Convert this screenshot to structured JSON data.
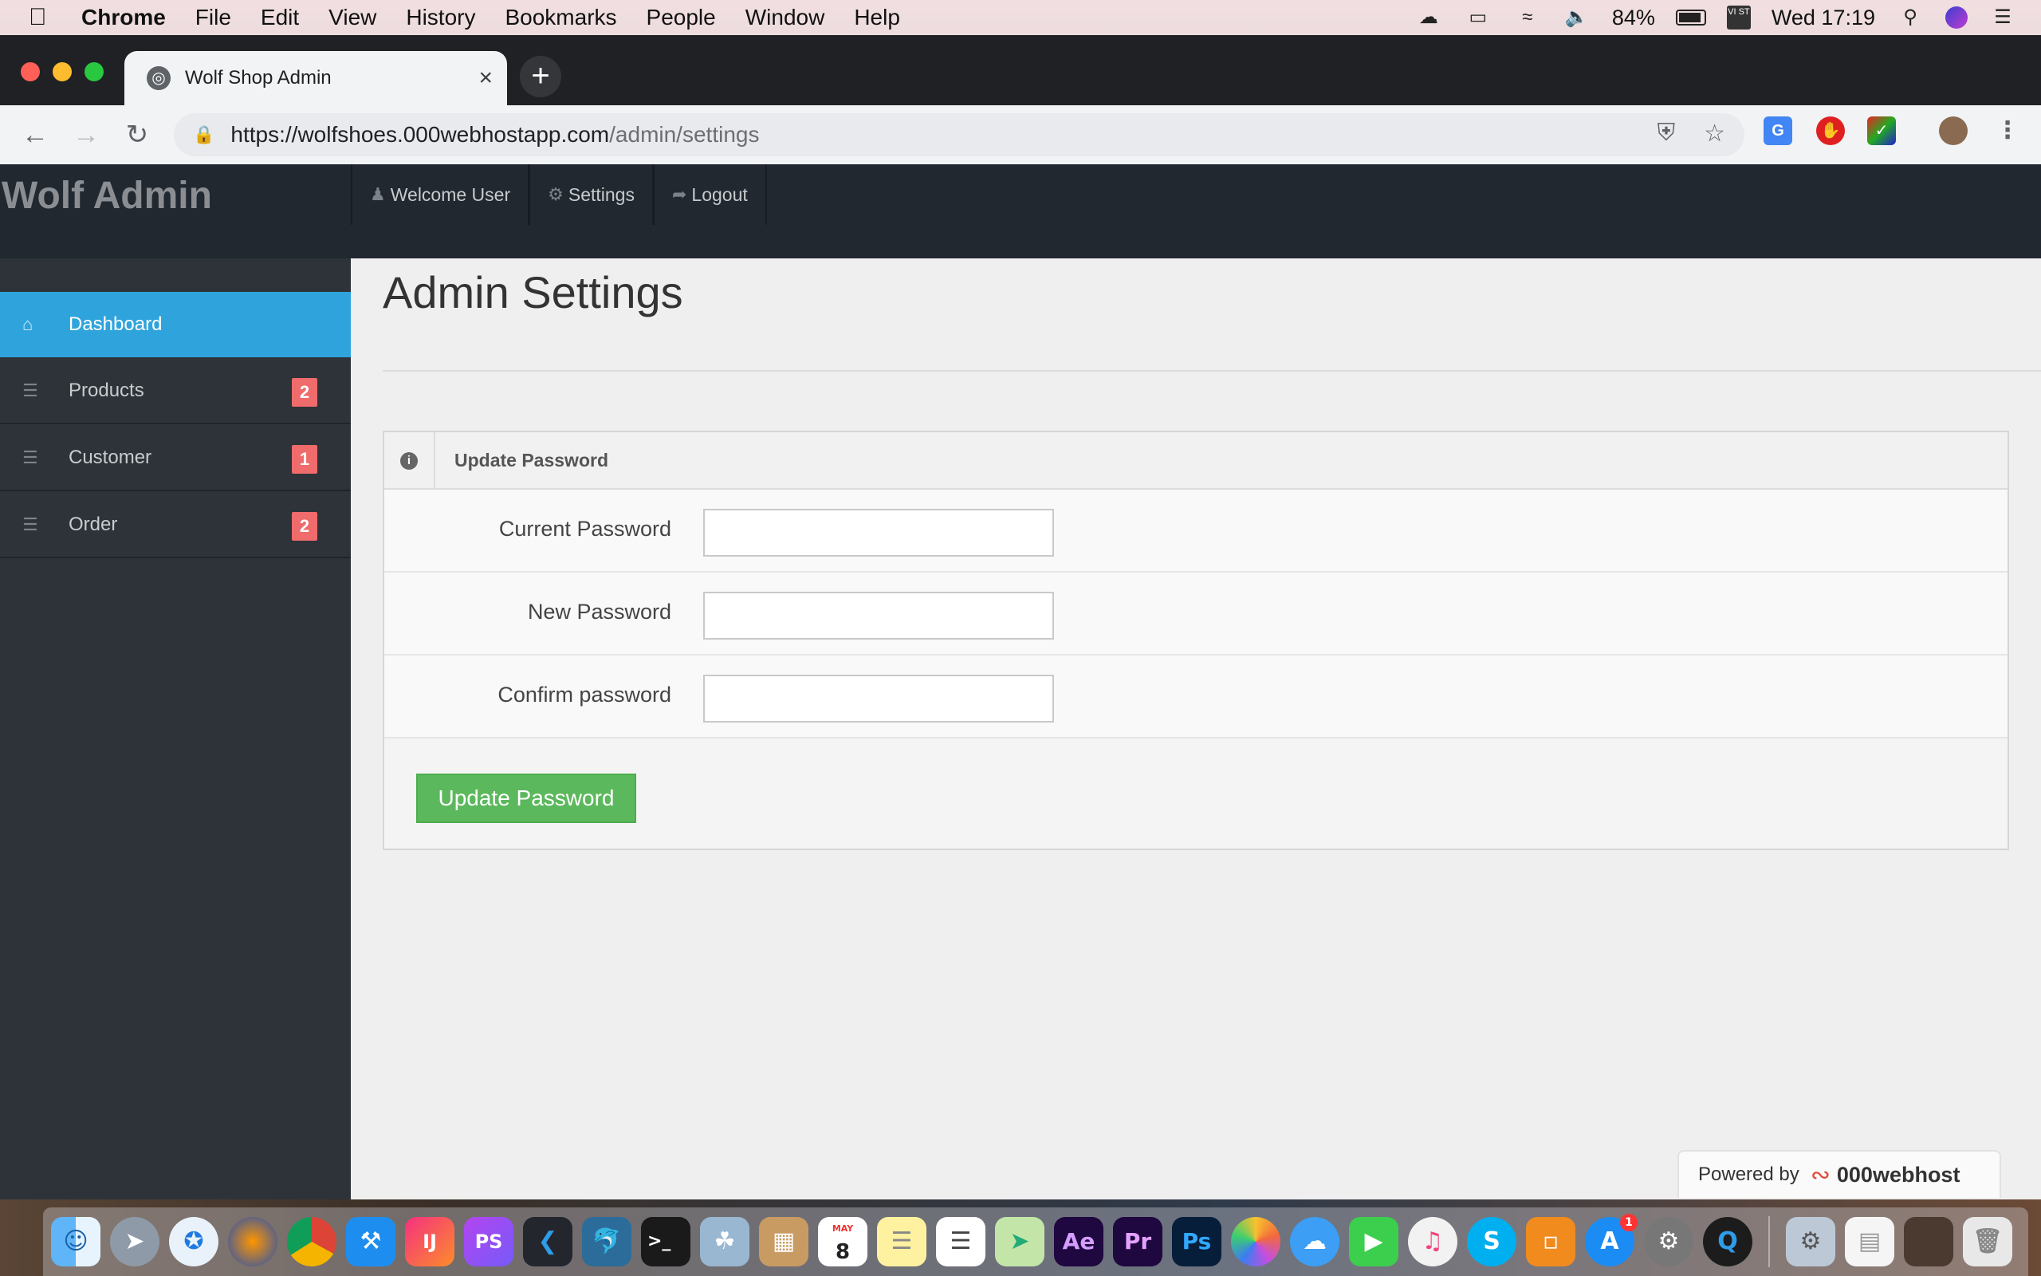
{
  "menubar": {
    "app": "Chrome",
    "items": [
      "File",
      "Edit",
      "View",
      "History",
      "Bookmarks",
      "People",
      "Window",
      "Help"
    ],
    "battery": "84%",
    "input_source": "VI ST",
    "clock": "Wed 17:19"
  },
  "browser": {
    "tab_title": "Wolf Shop Admin",
    "url_host": "https://wolfshoes.000webhostapp.com",
    "url_path": "/admin/settings"
  },
  "header": {
    "brand": "Wolf Admin",
    "nav": [
      {
        "label": "Welcome User",
        "icon": "user-icon"
      },
      {
        "label": "Settings",
        "icon": "gear-icon"
      },
      {
        "label": "Logout",
        "icon": "share-arrow-icon"
      }
    ]
  },
  "sidebar": {
    "items": [
      {
        "label": "Dashboard",
        "icon": "home-icon",
        "active": true
      },
      {
        "label": "Products",
        "icon": "list-icon",
        "badge": "2"
      },
      {
        "label": "Customer",
        "icon": "list-icon",
        "badge": "1"
      },
      {
        "label": "Order",
        "icon": "list-icon",
        "badge": "2"
      }
    ]
  },
  "main": {
    "title": "Admin Settings",
    "panel_title": "Update Password",
    "fields": [
      {
        "label": "Current Password",
        "value": ""
      },
      {
        "label": "New Password",
        "value": ""
      },
      {
        "label": "Confirm password",
        "value": ""
      }
    ],
    "submit_label": "Update Password"
  },
  "footer": {
    "powered_by": "Powered by",
    "host_name": "000webhost"
  },
  "colors": {
    "sidebar_active": "#2fa4dc",
    "badge": "#f06b6b",
    "submit": "#5cb85c",
    "topbar": "#212830"
  },
  "dock": {
    "apps": [
      "Finder",
      "Launchpad",
      "Safari",
      "Firefox",
      "Chrome",
      "Xcode",
      "IntelliJ IDEA",
      "PhpStorm",
      "Visual Studio Code",
      "MySQL Workbench",
      "Terminal",
      "Preview",
      "Notefile",
      "Calendar",
      "Notes",
      "Reminders",
      "Maps",
      "After Effects",
      "Premiere Pro",
      "Photoshop",
      "Photos",
      "Messages",
      "FaceTime",
      "iTunes",
      "Skype",
      "iBooks",
      "App Store",
      "System Preferences",
      "QuickTime Player",
      "Utility",
      "Document",
      "Screenshot",
      "Trash"
    ],
    "calendar_month": "MAY",
    "calendar_day": "8",
    "appstore_badge": "1"
  }
}
